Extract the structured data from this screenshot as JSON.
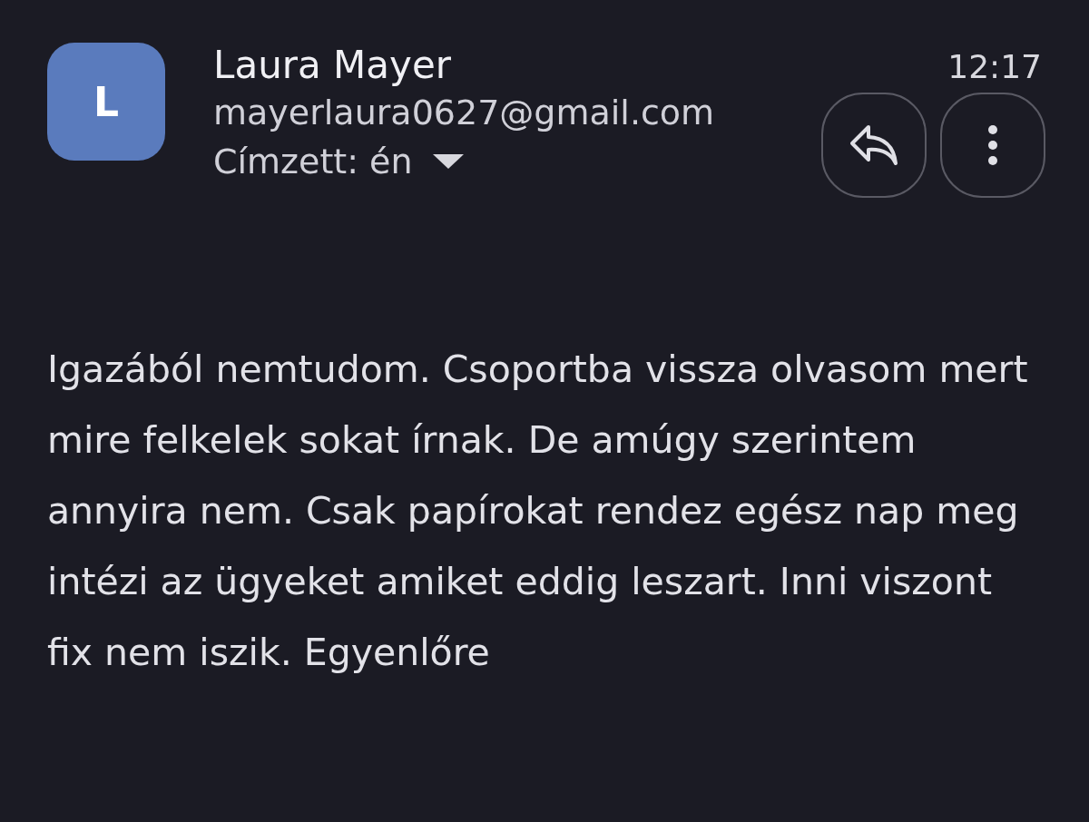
{
  "sender": {
    "initial": "L",
    "name": "Laura Mayer",
    "email": "mayerlaura0627@gmail.com",
    "recipient": "Címzett: én",
    "time": "12:17"
  },
  "body": "Igazából nemtudom. Csoportba vissza olvasom mert mire felkelek sokat írnak. De amúgy szerintem annyira nem. Csak papírokat rendez egész nap meg intézi az ügyeket amiket eddig leszart. Inni viszont fix nem iszik. Egyenlőre"
}
